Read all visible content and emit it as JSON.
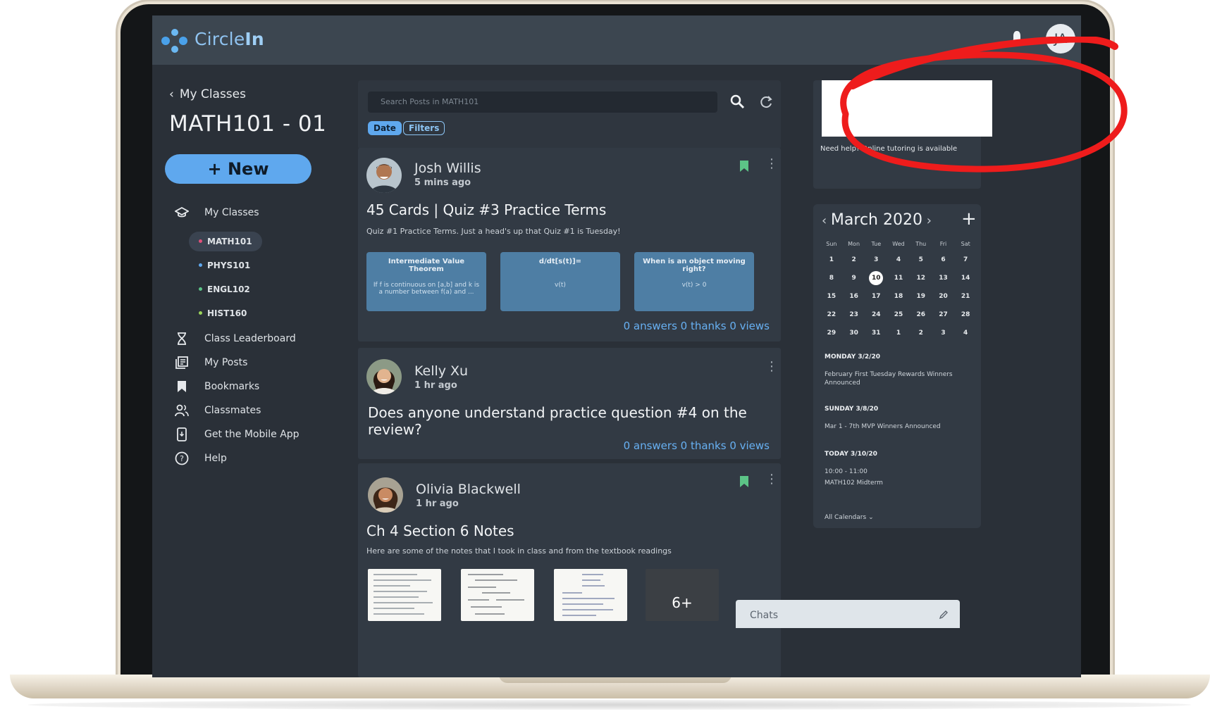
{
  "app": {
    "brand_light": "Circle",
    "brand_bold": "In",
    "user_initials": "JA",
    "accent": "#5fa8ee"
  },
  "sidebar": {
    "back_label": "My Classes",
    "class_title": "MATH101 - 01",
    "new_button": "+ New",
    "my_classes_label": "My Classes",
    "classes": [
      {
        "name": "MATH101",
        "color": "#e0507a",
        "active": true
      },
      {
        "name": "PHYS101",
        "color": "#5fa8ee",
        "active": false
      },
      {
        "name": "ENGL102",
        "color": "#5cc487",
        "active": false
      },
      {
        "name": "HIST160",
        "color": "#9bd45a",
        "active": false
      }
    ],
    "items": [
      {
        "label": "Class Leaderboard",
        "icon": "hourglass-icon"
      },
      {
        "label": "My Posts",
        "icon": "posts-icon"
      },
      {
        "label": "Bookmarks",
        "icon": "bookmark-icon"
      },
      {
        "label": "Classmates",
        "icon": "classmates-icon"
      },
      {
        "label": "Get the Mobile App",
        "icon": "mobile-icon"
      },
      {
        "label": "Help",
        "icon": "help-icon"
      }
    ]
  },
  "feed": {
    "search_placeholder": "Search Posts in MATH101",
    "chip_date": "Date",
    "chip_filters": "Filters",
    "posts": [
      {
        "author": "Josh Willis",
        "time": "5 mins ago",
        "title": "45 Cards | Quiz #3 Practice Terms",
        "body": "Quiz #1 Practice Terms. Just a head's up that Quiz #1 is Tuesday!",
        "cards": [
          {
            "front": "Intermediate Value Theorem",
            "back": "If f is continuous on [a,b] and k is a number between f(a) and ..."
          },
          {
            "front": "d/dt[s(t)]=",
            "back": "v(t)"
          },
          {
            "front": "When is an object moving right?",
            "back": "v(t) > 0"
          }
        ],
        "stats": "0 answers 0 thanks 0 views"
      },
      {
        "author": "Kelly Xu",
        "time": "1 hr ago",
        "title": "Does anyone understand practice question #4 on the review?",
        "stats": "0 answers 0 thanks 0 views"
      },
      {
        "author": "Olivia Blackwell",
        "time": "1 hr ago",
        "title": "Ch 4 Section 6 Notes",
        "body": "Here are some of the notes that I took in class and from the textbook readings",
        "more_count": "6+"
      }
    ]
  },
  "promo": {
    "text": "Need help? Online tutoring is available"
  },
  "calendar": {
    "month": "March 2020",
    "weekdays": [
      "Sun",
      "Mon",
      "Tue",
      "Wed",
      "Thu",
      "Fri",
      "Sat"
    ],
    "weeks": [
      [
        "1",
        "2",
        "3",
        "4",
        "5",
        "6",
        "7"
      ],
      [
        "8",
        "9",
        "10",
        "11",
        "12",
        "13",
        "14"
      ],
      [
        "15",
        "16",
        "17",
        "18",
        "19",
        "20",
        "21"
      ],
      [
        "22",
        "23",
        "24",
        "25",
        "26",
        "27",
        "28"
      ],
      [
        "29",
        "30",
        "31",
        "1",
        "2",
        "3",
        "4"
      ]
    ],
    "today": "10",
    "events": [
      {
        "day": "MONDAY  3/2/20",
        "text": "February First Tuesday Rewards Winners Announced"
      },
      {
        "day": "SUNDAY  3/8/20",
        "text": "Mar 1 - 7th MVP Winners Announced"
      },
      {
        "day": "TODAY  3/10/20",
        "time": "10:00 - 11:00",
        "text": "MATH102 Midterm"
      }
    ],
    "all_calendars": "All Calendars"
  },
  "chats": {
    "label": "Chats"
  }
}
